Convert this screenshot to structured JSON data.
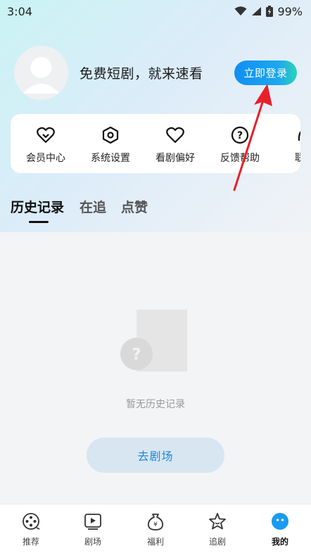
{
  "status_bar": {
    "time": "3:04",
    "battery": "99%"
  },
  "profile": {
    "slogan": "免费短剧，就来速看",
    "login_label": "立即登录"
  },
  "actions": [
    {
      "label": "会员中心",
      "icon": "vip-heart-icon"
    },
    {
      "label": "系统设置",
      "icon": "hexagon-settings-icon"
    },
    {
      "label": "看剧偏好",
      "icon": "heart-icon"
    },
    {
      "label": "反馈帮助",
      "icon": "question-icon"
    },
    {
      "label": "联系",
      "icon": "contact-icon"
    }
  ],
  "tabs": [
    {
      "label": "历史记录",
      "active": true
    },
    {
      "label": "在追",
      "active": false
    },
    {
      "label": "点赞",
      "active": false
    }
  ],
  "empty_state": {
    "message": "暂无历史记录",
    "button_label": "去剧场"
  },
  "bottom_nav": [
    {
      "label": "推荐",
      "icon": "film-reel-icon"
    },
    {
      "label": "剧场",
      "icon": "play-box-icon"
    },
    {
      "label": "福利",
      "icon": "money-bag-icon"
    },
    {
      "label": "追剧",
      "icon": "star-icon"
    },
    {
      "label": "我的",
      "icon": "profile-face-icon",
      "active": true
    }
  ],
  "colors": {
    "accent": "#1a9af0",
    "annotation": "#e8202a"
  }
}
